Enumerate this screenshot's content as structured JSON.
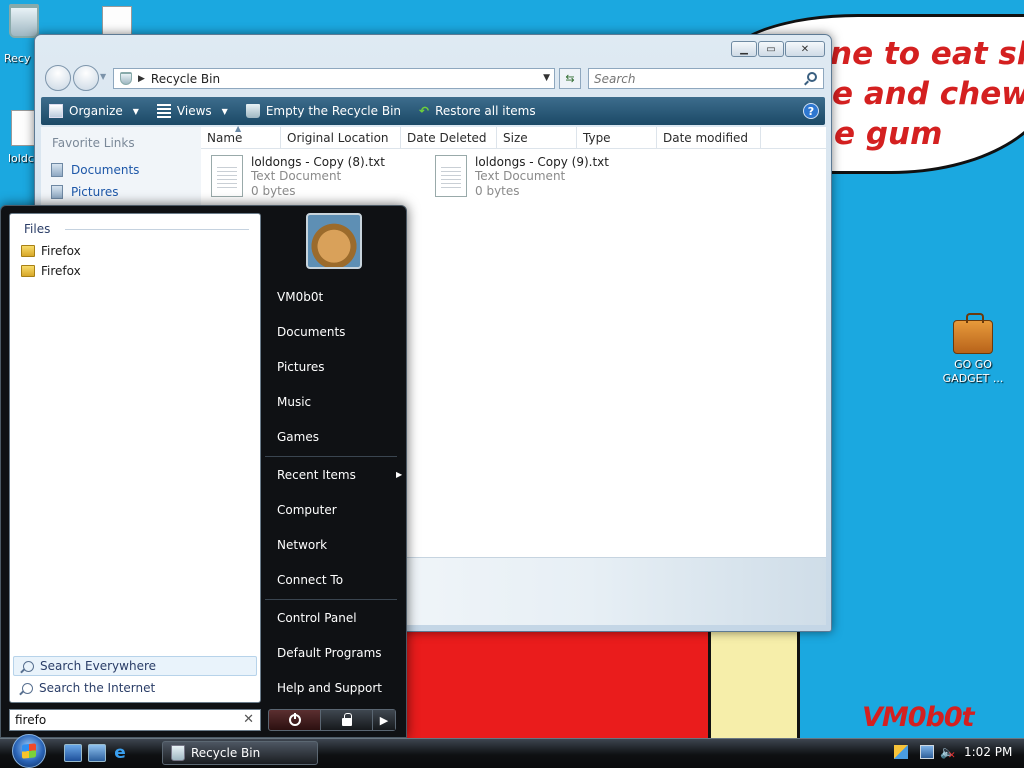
{
  "wallpaper": {
    "bubble_lines": [
      "ne to eat shit",
      "e and chew",
      "e gum"
    ],
    "signature": "VM0b0t"
  },
  "desktop": {
    "icons": [
      {
        "label": "Recy",
        "icon": "recycle-bin-icon"
      },
      {
        "label": "",
        "icon": "text-file-icon"
      },
      {
        "label": "loldc",
        "icon": "text-file-icon"
      },
      {
        "label": "GO GO GADGET ...",
        "icon": "briefcase-icon"
      }
    ]
  },
  "explorer": {
    "address": "Recycle Bin",
    "search_placeholder": "Search",
    "commands": {
      "organize": "Organize",
      "views": "Views",
      "empty": "Empty the Recycle Bin",
      "restore": "Restore all items"
    },
    "nav": {
      "heading": "Favorite Links",
      "items": [
        "Documents",
        "Pictures"
      ]
    },
    "columns": [
      "Name",
      "Original Location",
      "Date Deleted",
      "Size",
      "Type",
      "Date modified"
    ],
    "files": [
      {
        "name": "loldongs - Copy (8).txt",
        "type": "Text Document",
        "size": "0 bytes"
      },
      {
        "name": "loldongs - Copy (9).txt",
        "type": "Text Document",
        "size": "0 bytes"
      }
    ]
  },
  "start_menu": {
    "results_heading": "Files",
    "results": [
      "Firefox",
      "Firefox"
    ],
    "search_everywhere": "Search Everywhere",
    "search_internet": "Search the Internet",
    "search_value": "firefo",
    "user": "VM0b0t",
    "right_items": [
      "Documents",
      "Pictures",
      "Music",
      "Games",
      "Recent Items",
      "Computer",
      "Network",
      "Connect To",
      "Control Panel",
      "Default Programs",
      "Help and Support"
    ]
  },
  "taskbar": {
    "task_label": "Recycle Bin",
    "clock": "1:02 PM"
  },
  "colors": {
    "desktop": "#1ba8e0",
    "accent_red": "#d42020",
    "start_menu": "#0f1114",
    "command_bar": "#1b4966"
  }
}
